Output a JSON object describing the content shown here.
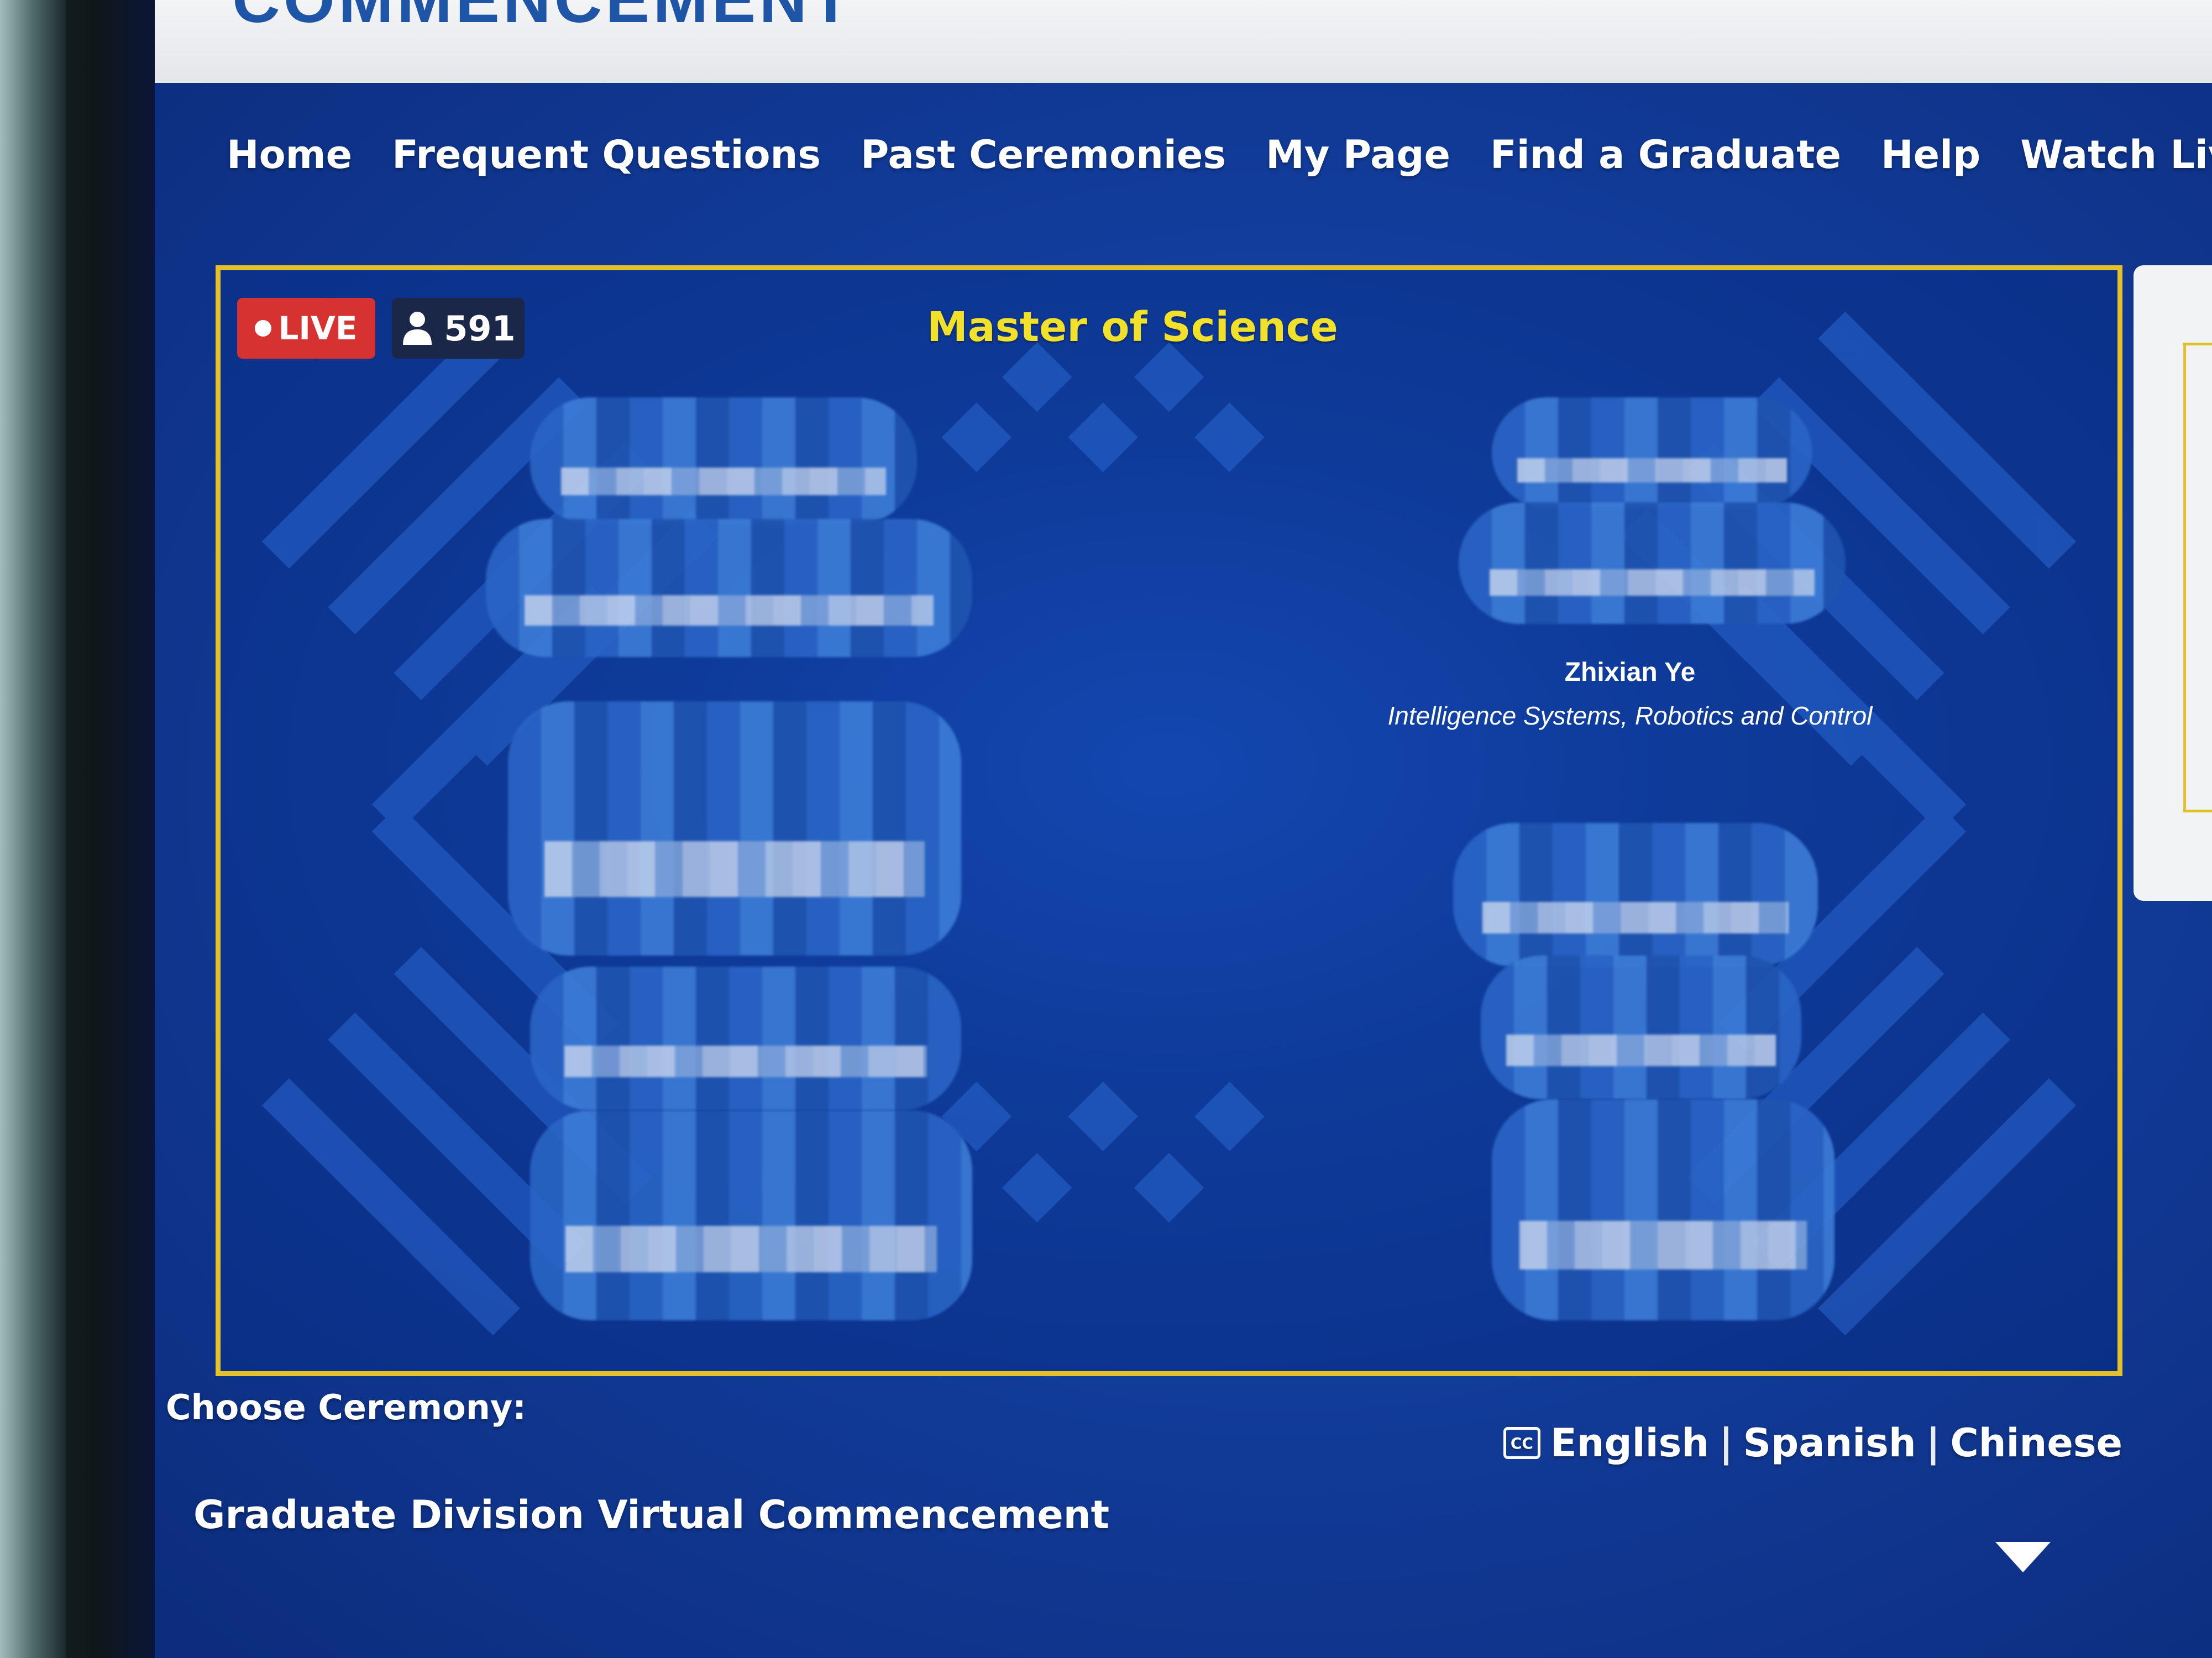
{
  "header": {
    "partial_logo_text": "COMMENCEMENT"
  },
  "nav": {
    "items": [
      {
        "label": "Home"
      },
      {
        "label": "Frequent Questions"
      },
      {
        "label": "Past Ceremonies"
      },
      {
        "label": "My Page"
      },
      {
        "label": "Find a Graduate"
      },
      {
        "label": "Help"
      },
      {
        "label": "Watch Live"
      }
    ]
  },
  "video": {
    "live_label": "LIVE",
    "viewer_count": "591",
    "viewer_icon": "person-icon",
    "slide_title": "Master of Science",
    "graduate": {
      "name": "Zhixian Ye",
      "program": "Intelligence Systems, Robotics and Control"
    }
  },
  "ceremony": {
    "label": "Choose Ceremony:",
    "selected": "Graduate Division Virtual Commencement"
  },
  "captions": {
    "icon": "cc-icon",
    "languages": [
      "English",
      "Spanish",
      "Chinese"
    ],
    "separator": "|"
  },
  "colors": {
    "page_background": "#123d9c",
    "frame_border": "#e4c12a",
    "title_yellow": "#f1e12b",
    "live_red": "#d63232"
  }
}
